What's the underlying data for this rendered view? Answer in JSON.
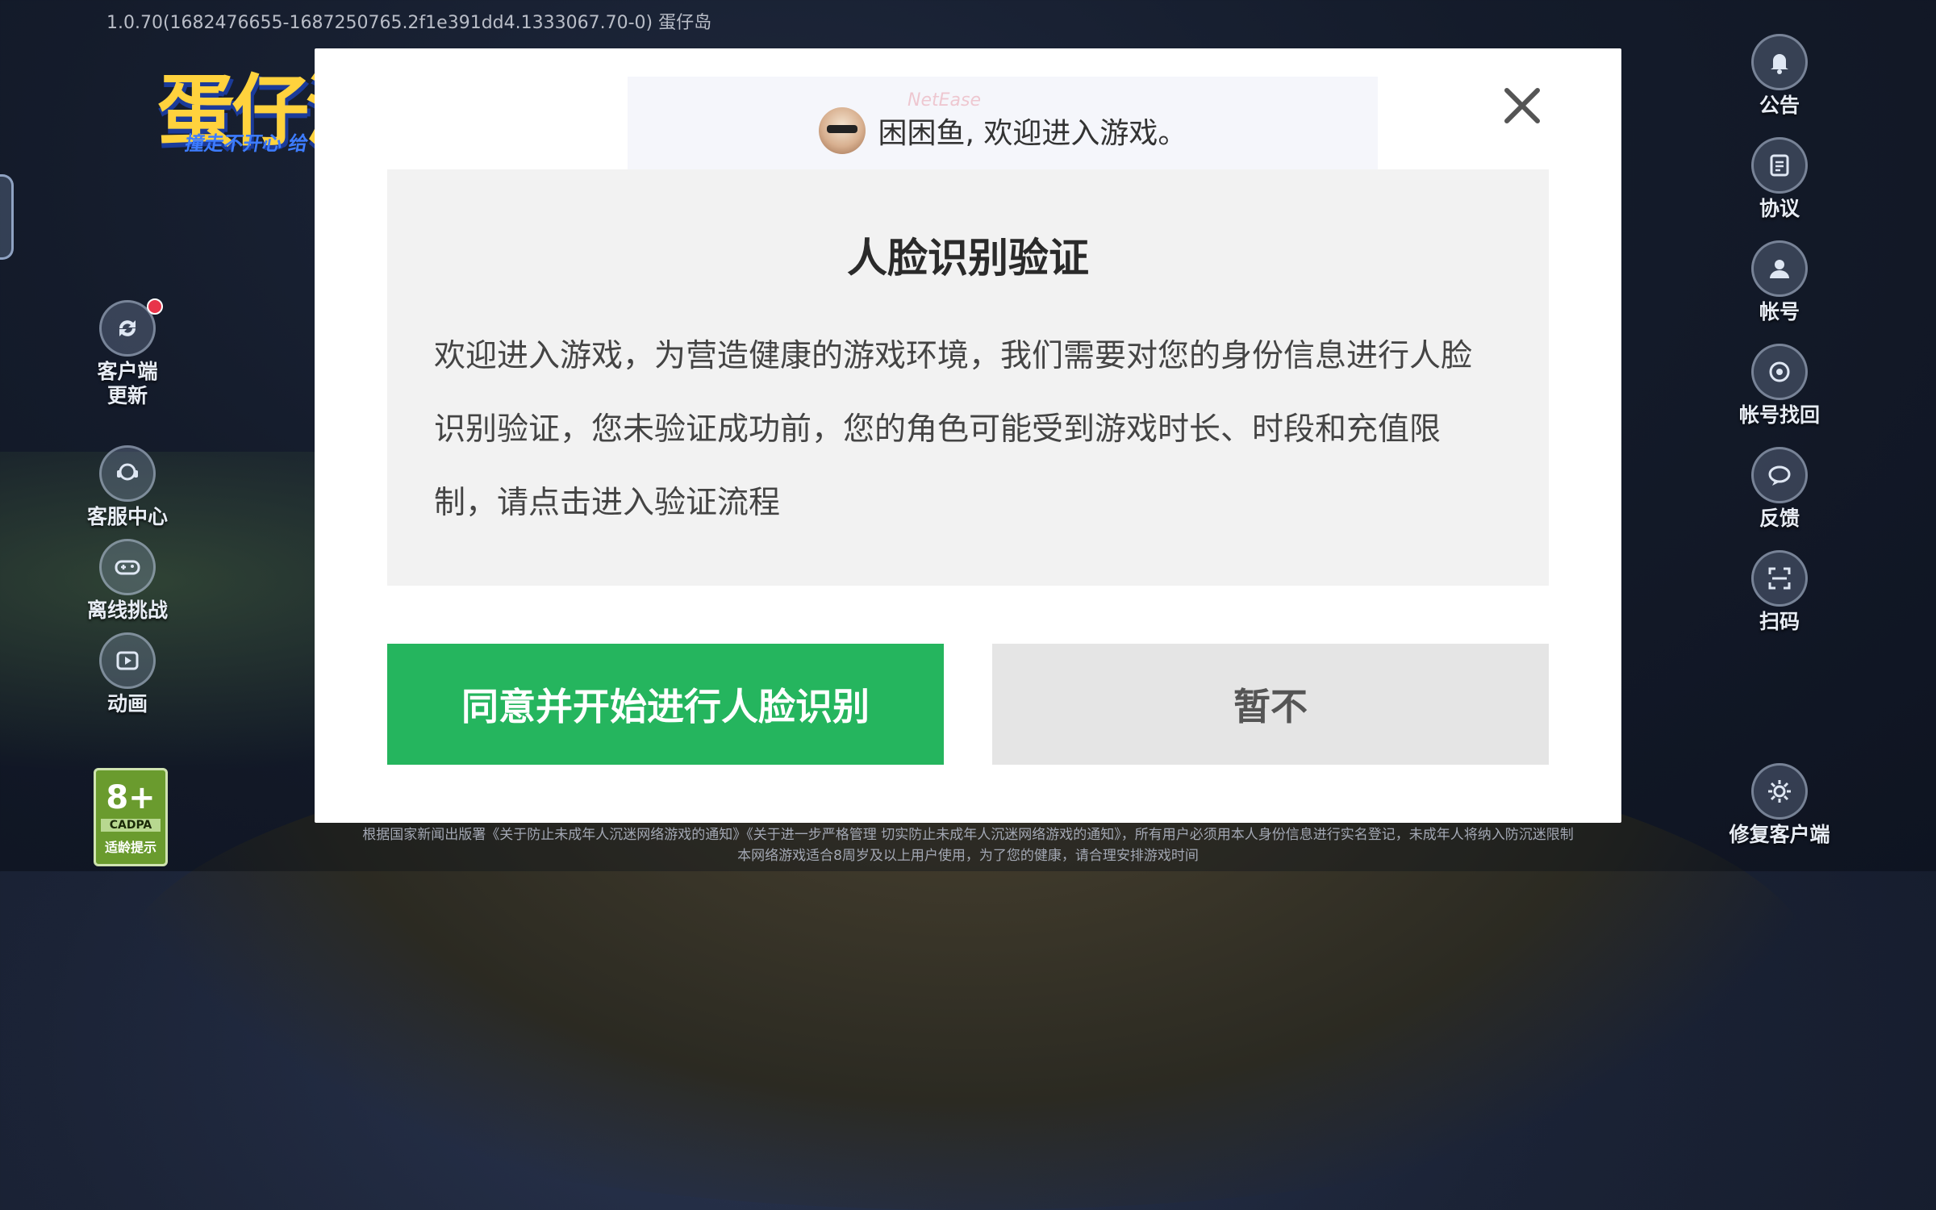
{
  "header": {
    "version_text": "1.0.70(1682476655-1687250765.2f1e391dd4.1333067.70-0)   蛋仔岛",
    "logo_text": "蛋仔派对",
    "logo_subtitle": "撞走不开心 给"
  },
  "left_menu": [
    {
      "label": "客户端\n更新",
      "icon": "refresh-icon",
      "has_badge": true
    },
    {
      "label": "客服中心",
      "icon": "customer-service-icon"
    },
    {
      "label": "离线挑战",
      "icon": "gamepad-icon"
    },
    {
      "label": "动画",
      "icon": "play-video-icon"
    }
  ],
  "right_menu": [
    {
      "label": "公告",
      "icon": "bell-icon"
    },
    {
      "label": "协议",
      "icon": "agreement-icon"
    },
    {
      "label": "帐号",
      "icon": "account-icon"
    },
    {
      "label": "帐号找回",
      "icon": "account-recovery-icon"
    },
    {
      "label": "反馈",
      "icon": "feedback-icon"
    },
    {
      "label": "扫码",
      "icon": "scan-icon"
    },
    {
      "label": "修复客户端",
      "icon": "gear-icon"
    }
  ],
  "age_rating": {
    "number": "8+",
    "code": "CADPA",
    "label": "适龄提示"
  },
  "footer_notice": {
    "line1": "根据国家新闻出版署《关于防止未成年人沉迷网络游戏的通知》《关于进一步严格管理 切实防止未成年人沉迷网络游戏的通知》，所有用户必须用本人身份信息进行实名登记，未成年人将纳入防沉迷限制",
    "line2": "本网络游戏适合8周岁及以上用户使用，为了您的健康，请合理安排游戏时间"
  },
  "modal": {
    "greeting": "困困鱼, 欢迎进入游戏。",
    "watermark": "NetEase",
    "title": "人脸识别验证",
    "body": "欢迎进入游戏，为营造健康的游戏环境，我们需要对您的身份信息进行人脸识别验证，您未验证成功前，您的角色可能受到游戏时长、时段和充值限制，请点击进入验证流程",
    "agree_button": "同意并开始进行人脸识别",
    "decline_button": "暂不"
  },
  "colors": {
    "agree_green": "#25b55e",
    "decline_grey": "#e5e5e5",
    "content_bg": "#f2f2f2"
  }
}
